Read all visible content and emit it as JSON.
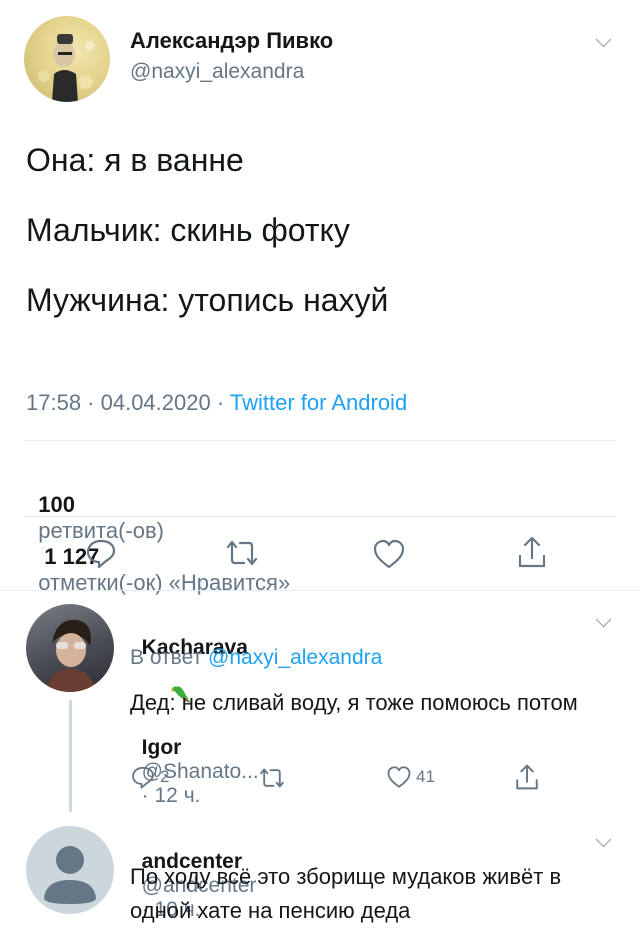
{
  "main_tweet": {
    "author_name": "Александэр Пивко",
    "author_handle": "@naxyi_alexandra",
    "lines": [
      "Она: я в ванне",
      "Мальчик: скинь фотку",
      "Мужчина: утопись нахуй"
    ],
    "time": "17:58 · 04.04.2020 · ",
    "source": "Twitter for Android",
    "retweet_count": "100",
    "retweet_label": "ретвита(-ов)",
    "like_count": "1 127",
    "like_label": "отметки(-ок) «Нравится»"
  },
  "reply1": {
    "name_left": "Kacharava",
    "name_right": "Igor",
    "handle": "@Shanato...",
    "time": "· 12 ч.",
    "reply_prefix": "В ответ ",
    "reply_to": "@naxyi_alexandra",
    "text": "Дед: не сливай воду, я тоже помоюсь потом",
    "comments": "2",
    "likes": "41"
  },
  "reply2": {
    "name": "andcenter",
    "handle": "@andcenter",
    "time": "· 10 ч.",
    "text": "По ходу всё это зборище мудаков живёт в одной хате на пенсию деда"
  }
}
